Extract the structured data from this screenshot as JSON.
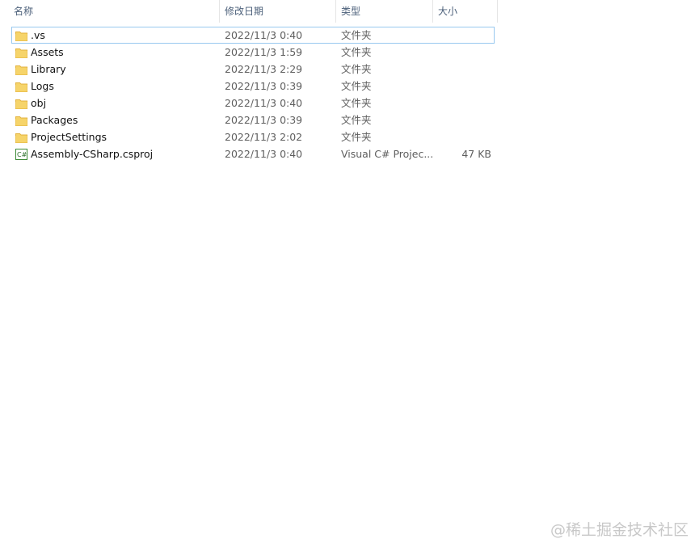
{
  "columns": {
    "name": "名称",
    "date": "修改日期",
    "type": "类型",
    "size": "大小"
  },
  "sort": {
    "column": "name",
    "direction": "ascending",
    "icon": "sort-up-arrow-icon"
  },
  "files": [
    {
      "name": ".vs",
      "date": "2022/11/3 0:40",
      "type": "文件夹",
      "size": "",
      "icon": "folder-icon",
      "selected": true
    },
    {
      "name": "Assets",
      "date": "2022/11/3 1:59",
      "type": "文件夹",
      "size": "",
      "icon": "folder-icon"
    },
    {
      "name": "Library",
      "date": "2022/11/3 2:29",
      "type": "文件夹",
      "size": "",
      "icon": "folder-icon"
    },
    {
      "name": "Logs",
      "date": "2022/11/3 0:39",
      "type": "文件夹",
      "size": "",
      "icon": "folder-icon"
    },
    {
      "name": "obj",
      "date": "2022/11/3 0:40",
      "type": "文件夹",
      "size": "",
      "icon": "folder-icon"
    },
    {
      "name": "Packages",
      "date": "2022/11/3 0:39",
      "type": "文件夹",
      "size": "",
      "icon": "folder-icon"
    },
    {
      "name": "ProjectSettings",
      "date": "2022/11/3 2:02",
      "type": "文件夹",
      "size": "",
      "icon": "folder-icon"
    },
    {
      "name": "Assembly-CSharp.csproj",
      "date": "2022/11/3 0:40",
      "type": "Visual C# Projec...",
      "size": "47 KB",
      "icon": "csharp-project-icon"
    }
  ],
  "watermark": "@稀土掘金技术社区",
  "colors": {
    "folder": "#f6d46a",
    "folder_shade": "#e3b23c",
    "selection_border": "#99c9ef",
    "header_text": "#4c607a"
  }
}
